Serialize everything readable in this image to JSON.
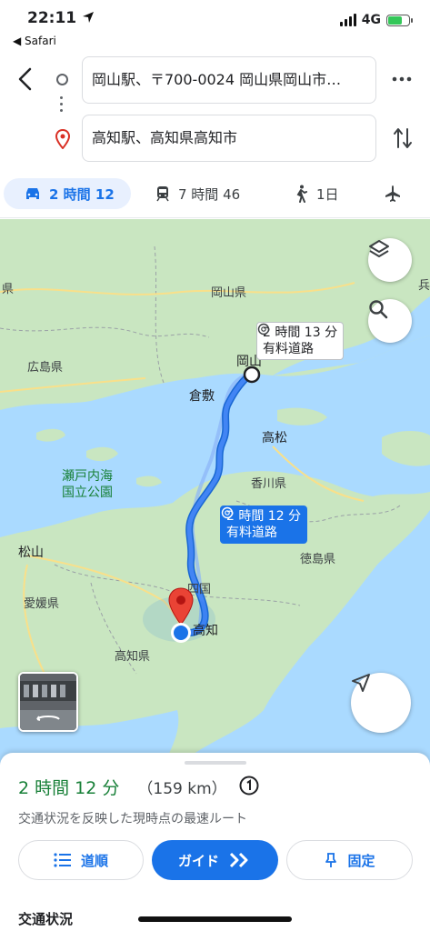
{
  "status_bar": {
    "time": "22:11",
    "back_app": "◀ Safari",
    "network": "4G"
  },
  "directions": {
    "origin": "岡山駅、〒700-0024 岡山県岡山市…",
    "destination": "高知駅、高知県高知市"
  },
  "modes": [
    {
      "icon": "car-icon",
      "label": "2 時間 12"
    },
    {
      "icon": "train-icon",
      "label": "7 時間 46"
    },
    {
      "icon": "walk-icon",
      "label": "1日"
    },
    {
      "icon": "flight-icon",
      "label": ""
    }
  ],
  "map": {
    "labels": {
      "okayama_pref": "岡山県",
      "hiroshima_pref": "広島県",
      "kagawa_pref": "香川県",
      "tokushima_pref": "徳島県",
      "ehime_pref": "愛媛県",
      "kochi_pref": "高知県",
      "setonaikai": "瀬戸内海\n国立公園",
      "shikoku": "四国",
      "left_edge": "県",
      "right_edge": "兵"
    },
    "cities": {
      "okayama": "岡山",
      "kurashiki": "倉敷",
      "takamatsu": "高松",
      "matsuyama": "松山",
      "kochi": "高知"
    },
    "route_alt": {
      "time": "2 時間 13 分",
      "toll": "有料道路"
    },
    "route_main": {
      "time": "2 時間 12 分",
      "toll": "有料道路"
    }
  },
  "sheet": {
    "duration": "2 時間 12 分",
    "distance": "（159 km）",
    "description": "交通状況を反映した現時点の最速ルート",
    "buttons": {
      "steps": "道順",
      "guide": "ガイド",
      "pin": "固定"
    },
    "traffic_title": "交通状況"
  },
  "colors": {
    "accent": "#1a73e8",
    "duration_green": "#188038",
    "route_blue": "#4285f4",
    "water": "#aadaff",
    "land": "#c9e6c1"
  }
}
